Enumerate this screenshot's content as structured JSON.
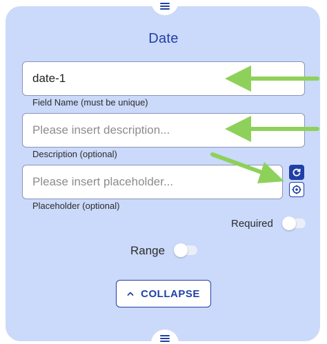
{
  "form": {
    "title": "Date",
    "field_name": {
      "value": "date-1",
      "help": "Field Name (must be unique)"
    },
    "description": {
      "value": "",
      "placeholder": "Please insert description...",
      "help": "Description (optional)"
    },
    "placeholder": {
      "value": "",
      "placeholder": "Please insert placeholder...",
      "help": "Placeholder (optional)"
    },
    "required": {
      "label": "Required",
      "on": false
    },
    "range": {
      "label": "Range",
      "on": false
    },
    "collapse_label": "COLLAPSE"
  },
  "icons": {
    "handle": "hamburger-icon",
    "reset": "refresh-icon",
    "picker": "target-icon",
    "collapse": "chevron-up-icon"
  },
  "colors": {
    "panel": "#cbd9fa",
    "accent": "#1f3fa6",
    "annotation_arrow": "#8ed15a"
  }
}
